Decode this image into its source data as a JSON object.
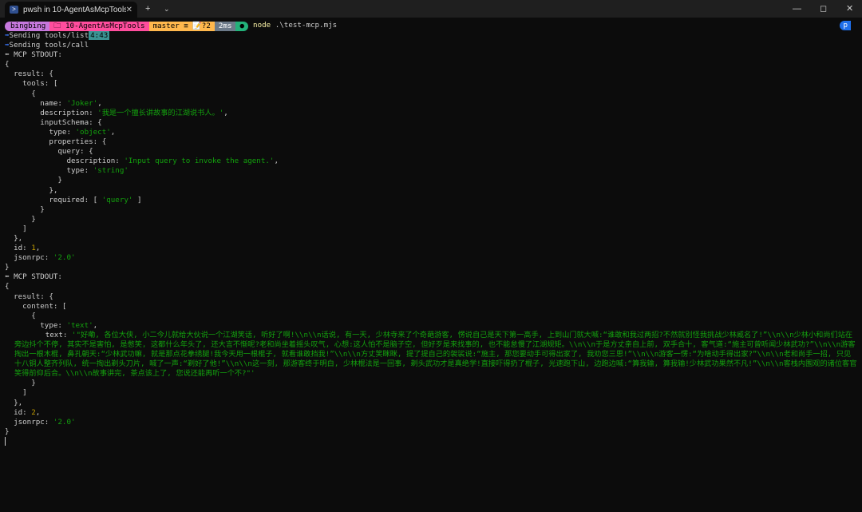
{
  "window": {
    "tab_title": "pwsh in 10-AgentAsMcpTools",
    "tab_close": "✕",
    "new_tab": "+",
    "dropdown": "⌄",
    "minimize": "—",
    "maximize": "◻",
    "close": "✕"
  },
  "prompt": {
    "user": "bingbing",
    "dir": "10-AgentAsMcpTools",
    "git": "master ≡ 📝?2",
    "duration": "2ms",
    "status_icon": "●",
    "command": "node",
    "args": ".\\test-mcp.mjs",
    "right": "p"
  },
  "output": {
    "send_list": "Sending tools/list",
    "send_list_time": "4:43",
    "send_call": "Sending tools/call",
    "stdout_header": "⬅ MCP STDOUT:",
    "arrow": "➡",
    "tools_json": {
      "name": "'Joker'",
      "description": "'我是一个擅长讲故事的江湖说书人。'",
      "type_object": "'object'",
      "query_desc": "'Input query to invoke the agent.'",
      "type_string": "'string'",
      "required": "'query'",
      "id": "1",
      "jsonrpc": "'2.0'"
    },
    "call_json": {
      "type_text": "'text'",
      "text": "'\"好嘞, 各位大侠, 小二今儿就给大伙说一个江湖笑话, 听好了啊!\\\\n\\\\n话说, 有一天, 少林寺来了个奇葩游客, 愣说自己是天下第一高手, 上到山门就大喊:“谁敢和我过两招?不然就别怪我挑战少林威名了!”\\\\n\\\\n少林小和尚们站在旁边抖个不停, 其实不是害怕, 是憋笑, 这都什么年头了, 还大言不惭呢?老和尚坐着摇头叹气, 心想:这人怕不是脑子空, 但好歹是来找事的, 也不能怠慢了江湖规矩。\\\\n\\\\n于是方丈亲自上前, 双手合十, 客气道:“施主可曾听闻少林武功?”\\\\n\\\\n游客掏出一根木棍, 鼻孔朝天:“少林武功嘛, 就是那点花拳绣腿!我今天用一根棍子, 就看谁敢挡我!”\\\\n\\\\n方丈笑眯眯, 提了提自己的袈裟说:“施主, 那您要动手可得出家了, 我劝您三思!”\\\\n\\\\n游客一愣:“为啥动手得出家?”\\\\n\\\\n老和尚手一招, 只见十八铜人整齐列队, 统一掏出剃头刀片, 喊了一声:“剃好了他!”\\\\n\\\\n这一刻, 那游客终于明白, 少林棍法是一回事, 剃头武功才是真绝学!直接吓得扔了棍子, 光速跑下山, 边跑边喊:“算我输, 算我输!少林武功果然不凡!”\\\\n\\\\n客栈内围观的诸位客官笑得前仰后合。\\\\n\\\\n故事讲完, 茶点该上了, 您说还能再听一个不?\"'",
      "id": "2",
      "jsonrpc": "'2.0'"
    }
  }
}
